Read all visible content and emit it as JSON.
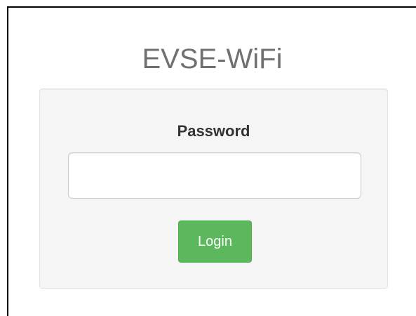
{
  "app": {
    "title": "EVSE-WiFi"
  },
  "login_form": {
    "password_label": "Password",
    "password_value": "",
    "login_button_label": "Login"
  },
  "colors": {
    "title_text": "#707070",
    "panel_background": "#f5f5f5",
    "login_button": "#5cb85c"
  }
}
